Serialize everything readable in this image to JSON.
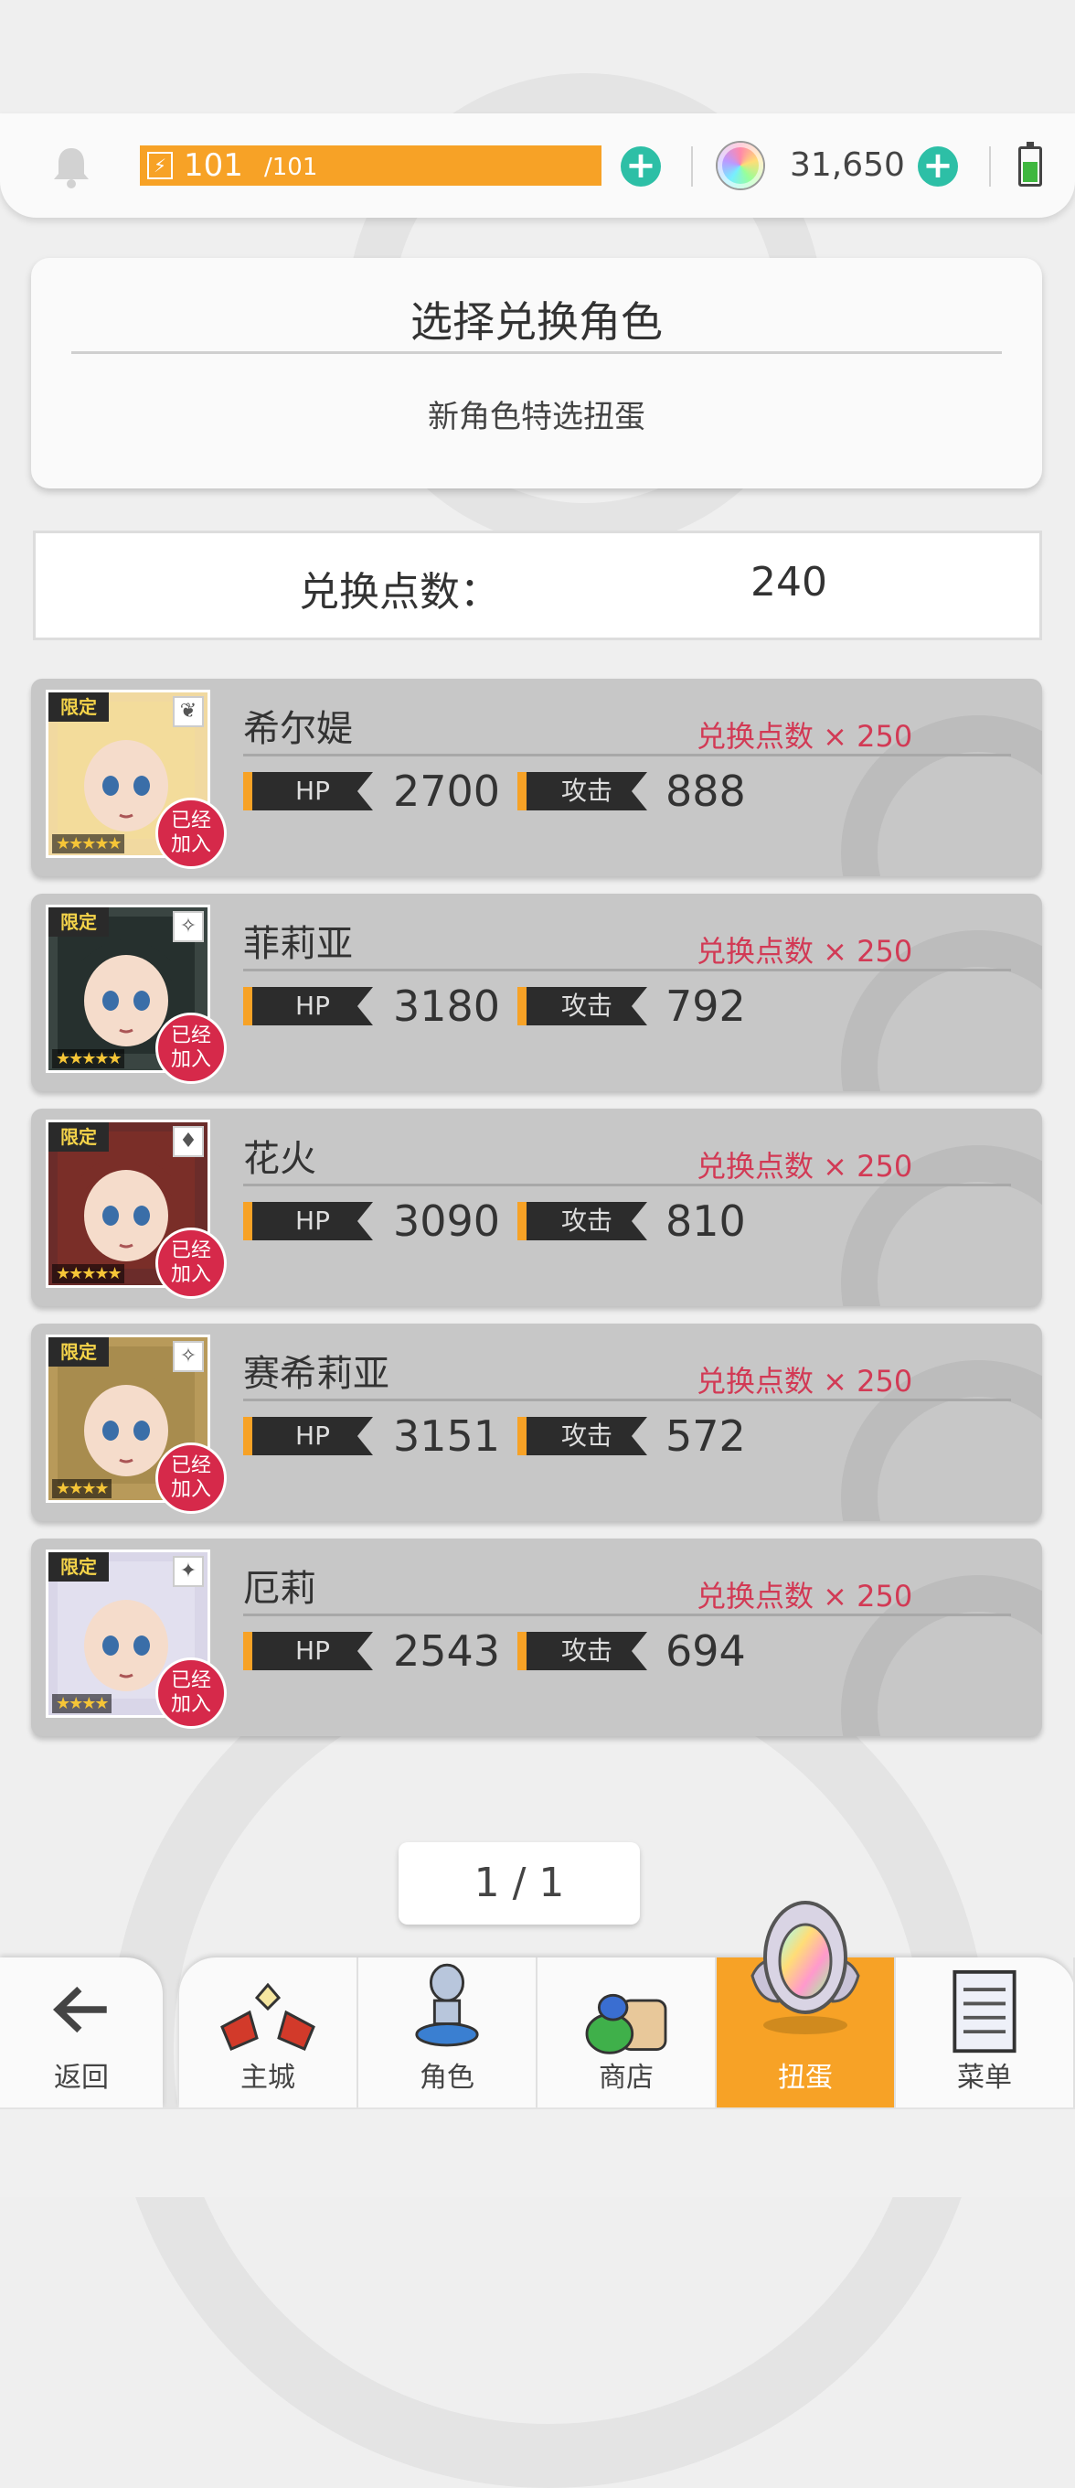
{
  "status_bar": {
    "energy_current": "101",
    "energy_max": "/101",
    "gems": "31,650",
    "energy_fill_percent": 100,
    "battery_level_percent": 50
  },
  "title_card": {
    "title": "选择兑换角色",
    "subtitle": "新角色特选扭蛋"
  },
  "points": {
    "label": "兑换点数：",
    "value": "240"
  },
  "stat_labels": {
    "hp": "HP",
    "atk": "攻击"
  },
  "joined_badge": {
    "line1": "已经",
    "line2": "加入"
  },
  "limited_label": "限定",
  "characters": [
    {
      "name": "希尔媞",
      "cost": "兑换点数 × 250",
      "hp": "2700",
      "atk": "888",
      "stars": 5,
      "element_icon": "leaf-icon",
      "portrait_color": "#f1d9a0",
      "hair_color": "#f3dc9b"
    },
    {
      "name": "菲莉亚",
      "cost": "兑换点数 × 250",
      "hp": "3180",
      "atk": "792",
      "stars": 5,
      "element_icon": "sparkle-icon",
      "portrait_color": "#3a4542",
      "hair_color": "#26302e"
    },
    {
      "name": "花火",
      "cost": "兑换点数 × 250",
      "hp": "3090",
      "atk": "810",
      "stars": 5,
      "element_icon": "diamond-icon",
      "portrait_color": "#6b2c2a",
      "hair_color": "#7a2e28"
    },
    {
      "name": "赛希莉亚",
      "cost": "兑换点数 × 250",
      "hp": "3151",
      "atk": "572",
      "stars": 4,
      "element_icon": "sparkle-icon",
      "portrait_color": "#b89a5a",
      "hair_color": "#a88c4e"
    },
    {
      "name": "厄莉",
      "cost": "兑换点数 × 250",
      "hp": "2543",
      "atk": "694",
      "stars": 4,
      "element_icon": "dark-star-icon",
      "portrait_color": "#d9d6e8",
      "hair_color": "#e2e0ef"
    }
  ],
  "pager": {
    "text": "1 / 1"
  },
  "nav": {
    "back_label": "返回",
    "items": [
      {
        "label": "主城",
        "icon": "castle-icon",
        "active": false
      },
      {
        "label": "角色",
        "icon": "character-icon",
        "active": false
      },
      {
        "label": "商店",
        "icon": "shop-icon",
        "active": false
      },
      {
        "label": "扭蛋",
        "icon": "gacha-icon",
        "active": true
      },
      {
        "label": "菜单",
        "icon": "menu-icon",
        "active": false
      }
    ]
  },
  "colors": {
    "accent_orange": "#f7a226",
    "plus_teal": "#2dbfa6",
    "cost_red": "#d23a55",
    "badge_red": "#d6294a"
  }
}
